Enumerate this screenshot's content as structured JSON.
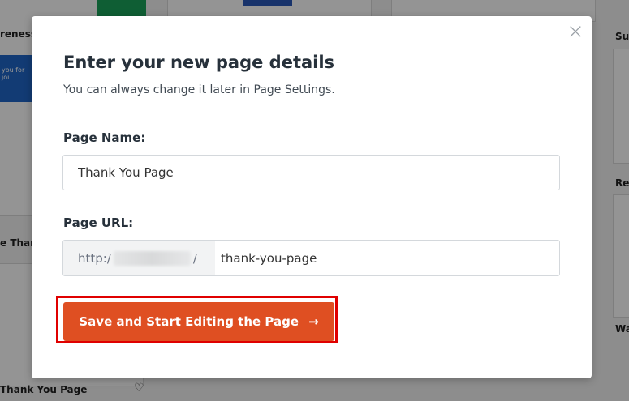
{
  "background": {
    "labels": [
      "reness",
      "Sul",
      "Rep",
      "e Than",
      "Wa",
      "Thank You Page"
    ],
    "thumb_text": [
      "you for joi"
    ],
    "heart_icon": "heart-icon"
  },
  "modal": {
    "close_icon": "close-icon",
    "title": "Enter your new page details",
    "subtitle": "You can always change it later in Page Settings.",
    "page_name_label": "Page Name:",
    "page_name_value": "Thank You Page",
    "page_url_label": "Page URL:",
    "url_prefix": "http:/",
    "url_prefix_end": "/",
    "page_url_value": "thank-you-page",
    "save_button_label": "Save and Start Editing the Page",
    "save_button_arrow": "→"
  },
  "colors": {
    "accent": "#df4f22",
    "highlight": "#e00000"
  }
}
